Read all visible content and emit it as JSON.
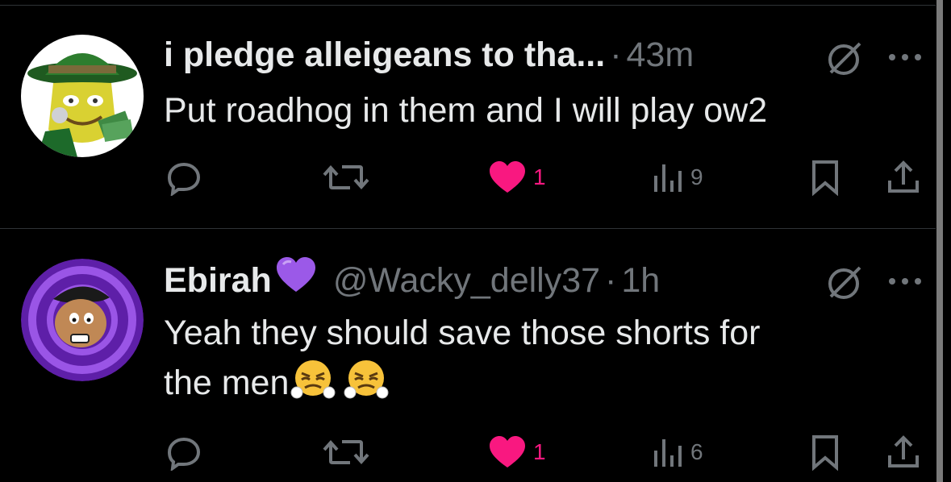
{
  "tweets": [
    {
      "display_name": "i pledge alleigeans to tha...",
      "handle": "",
      "separator": "·",
      "time": "43m",
      "text_lines": [
        "Put roadhog in them and I will play ow2"
      ],
      "actions": {
        "replies": "",
        "reposts": "",
        "likes": "1",
        "views": "9"
      },
      "liked": true
    },
    {
      "display_name": "Ebirah",
      "handle": "@Wacky_delly37",
      "separator": "·",
      "time": "1h",
      "text_lines": [
        "Yeah they should save those shorts for",
        "the men"
      ],
      "actions": {
        "replies": "",
        "reposts": "",
        "likes": "1",
        "views": "6"
      },
      "liked": true
    }
  ],
  "icons": {
    "reply": "reply-icon",
    "repost": "repost-icon",
    "like": "heart-icon",
    "views": "views-icon",
    "bookmark": "bookmark-icon",
    "share": "share-icon",
    "grok": "grok-icon",
    "more": "more-icon",
    "badge": "purple-heart-emoji",
    "emoji": "huffing-face-emoji"
  },
  "colors": {
    "background": "#000000",
    "text": "#e7e9ea",
    "muted": "#71767b",
    "like": "#f91880",
    "divider": "#2f3336",
    "badge": "#9b59e8"
  }
}
